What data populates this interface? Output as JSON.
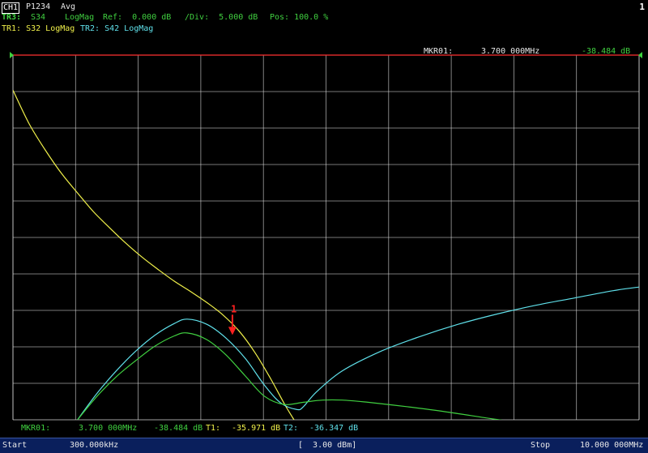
{
  "header": {
    "channel": "CH1",
    "ports": "P1234",
    "averaging": "Avg",
    "corner_number": "1",
    "line2": {
      "trace": "TR3:",
      "param": "S34",
      "format": "LogMag",
      "ref": "Ref:  0.000 dB",
      "div": "/Div:  5.000 dB",
      "pos": "Pos: 100.0 %"
    },
    "line3": {
      "tr1": "TR1: S32 LogMag",
      "tr2": "TR2: S42 LogMag"
    }
  },
  "marker_top": {
    "label": "MKR01:",
    "freq": "3.700 000MHz",
    "value": "-38.484 dB"
  },
  "marker_bottom": {
    "label": "MKR01:",
    "freq": "3.700 000MHz",
    "value": "-38.484  dB",
    "t1_label": "T1:",
    "t1_value": "-35.971  dB",
    "t2_label": "T2:",
    "t2_value": "-36.347  dB"
  },
  "marker_symbol": "1",
  "footer": {
    "start_label": "Start",
    "start_value": "300.000kHz",
    "power": "[  3.00 dBm]",
    "stop_label": "Stop",
    "stop_value": "10.000 000MHz"
  },
  "colors": {
    "tr1": "#f0f04a",
    "tr2": "#5fe0ea",
    "tr3": "#40d040",
    "grid": "#d8d8d8",
    "ref_line": "#ff3030",
    "marker": "#ff2020",
    "bottom_bar": "#0a1f5c"
  },
  "chart_data": {
    "type": "line",
    "xlabel": "",
    "ylabel": "",
    "xlim": [
      0.3,
      10.0
    ],
    "x_unit": "MHz",
    "ylim": [
      -50,
      0
    ],
    "y_unit": "dB",
    "grid": true,
    "series": [
      {
        "name": "TR1: S32 LogMag",
        "color": "#f0f04a",
        "x": [
          0.3,
          0.55,
          0.8,
          1.05,
          1.3,
          1.55,
          1.8,
          2.05,
          2.3,
          2.55,
          2.8,
          3.05,
          3.3,
          3.55,
          3.8,
          4.05,
          4.3,
          4.55,
          4.8
        ],
        "y": [
          -4.8,
          -9.4,
          -13.0,
          -16.2,
          -18.9,
          -21.5,
          -23.7,
          -25.8,
          -27.7,
          -29.4,
          -31.0,
          -32.4,
          -33.9,
          -35.6,
          -37.8,
          -40.8,
          -44.5,
          -48.5,
          -52.0
        ]
      },
      {
        "name": "TR2: S42 LogMag",
        "color": "#5fe0ea",
        "x": [
          1.3,
          1.6,
          1.9,
          2.2,
          2.5,
          2.8,
          3.0,
          3.3,
          3.6,
          3.9,
          4.2,
          4.45,
          4.7,
          4.8,
          5.0,
          5.4,
          6.0,
          6.6,
          7.2,
          7.8,
          8.4,
          9.0,
          9.6,
          10.0
        ],
        "y": [
          -50.0,
          -46.4,
          -43.3,
          -40.6,
          -38.4,
          -36.8,
          -36.2,
          -36.9,
          -38.8,
          -41.6,
          -45.3,
          -47.7,
          -48.6,
          -48.2,
          -46.2,
          -43.3,
          -40.6,
          -38.6,
          -36.9,
          -35.5,
          -34.3,
          -33.3,
          -32.3,
          -31.8
        ]
      },
      {
        "name": "TR3: S34 LogMag",
        "color": "#40d040",
        "x": [
          1.3,
          1.6,
          1.9,
          2.2,
          2.5,
          2.8,
          3.0,
          3.3,
          3.6,
          3.9,
          4.2,
          4.5,
          4.8,
          5.1,
          5.4,
          5.8,
          6.4,
          7.0,
          7.6,
          8.2,
          8.75
        ],
        "y": [
          -50.0,
          -46.8,
          -44.1,
          -41.9,
          -39.9,
          -38.5,
          -38.1,
          -39.0,
          -41.1,
          -44.0,
          -46.8,
          -47.9,
          -47.6,
          -47.3,
          -47.3,
          -47.6,
          -48.2,
          -48.9,
          -49.7,
          -50.5,
          -51.4
        ]
      }
    ],
    "markers": [
      {
        "name": "1",
        "x": 3.7,
        "y": -38.484
      }
    ],
    "reference_level": 0
  }
}
